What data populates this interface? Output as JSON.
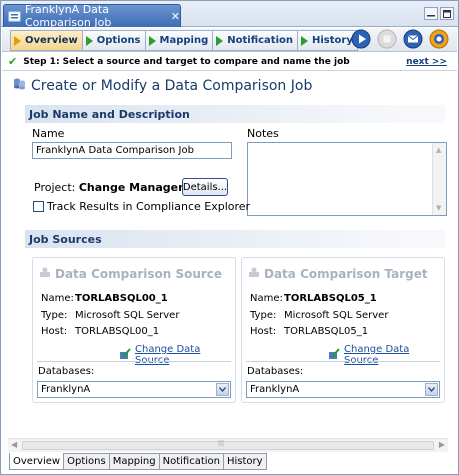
{
  "editor_tab": {
    "title": "FranklynA Data Comparison Job",
    "close_glyph": "✕"
  },
  "window_buttons": {
    "minimize_glyph": "─",
    "maximize_glyph": "□"
  },
  "steps": [
    {
      "label": "Overview",
      "active": true
    },
    {
      "label": "Options",
      "active": false
    },
    {
      "label": "Mapping",
      "active": false
    },
    {
      "label": "Notification",
      "active": false
    },
    {
      "label": "History",
      "active": false
    }
  ],
  "toolbar_icons": [
    "run-icon",
    "stop-icon",
    "email-icon",
    "help-icon"
  ],
  "instruction": {
    "text": "Step 1: Select a source and target to compare and name the job",
    "next_link": "next >>"
  },
  "page_title": "Create or Modify a Data Comparison Job",
  "job_section": {
    "title": "Job Name and Description",
    "name_label": "Name",
    "name_value": "FranklynA Data Comparison Job",
    "notes_label": "Notes",
    "project_label": "Project:",
    "project_value": "Change Management",
    "details_button": "Details...",
    "track_label": "Track Results in Compliance Explorer"
  },
  "sources_section": {
    "title": "Job Sources",
    "source": {
      "title": "Data Comparison Source",
      "name_key": "Name:",
      "name_value": "TORLABSQL00_1",
      "type_key": "Type:",
      "type_value": "Microsoft SQL Server",
      "host_key": "Host:",
      "host_value": "TORLABSQL00_1",
      "change_link": "Change Data Source",
      "databases_label": "Databases:",
      "databases_value": "FranklynA"
    },
    "target": {
      "title": "Data Comparison Target",
      "name_key": "Name:",
      "name_value": "TORLABSQL05_1",
      "type_key": "Type:",
      "type_value": "Microsoft SQL Server",
      "host_key": "Host:",
      "host_value": "TORLABSQL05_1",
      "change_link": "Change Data Source",
      "databases_label": "Databases:",
      "databases_value": "FranklynA"
    }
  },
  "bottom_tabs": [
    "Overview",
    "Options",
    "Mapping",
    "Notification",
    "History"
  ],
  "colors": {
    "accent": "#3d6db5",
    "heading": "#1b3a6b",
    "link": "#1c4fa0",
    "step_active": "#f6d58b",
    "step_arrow": "#2aa02a"
  }
}
